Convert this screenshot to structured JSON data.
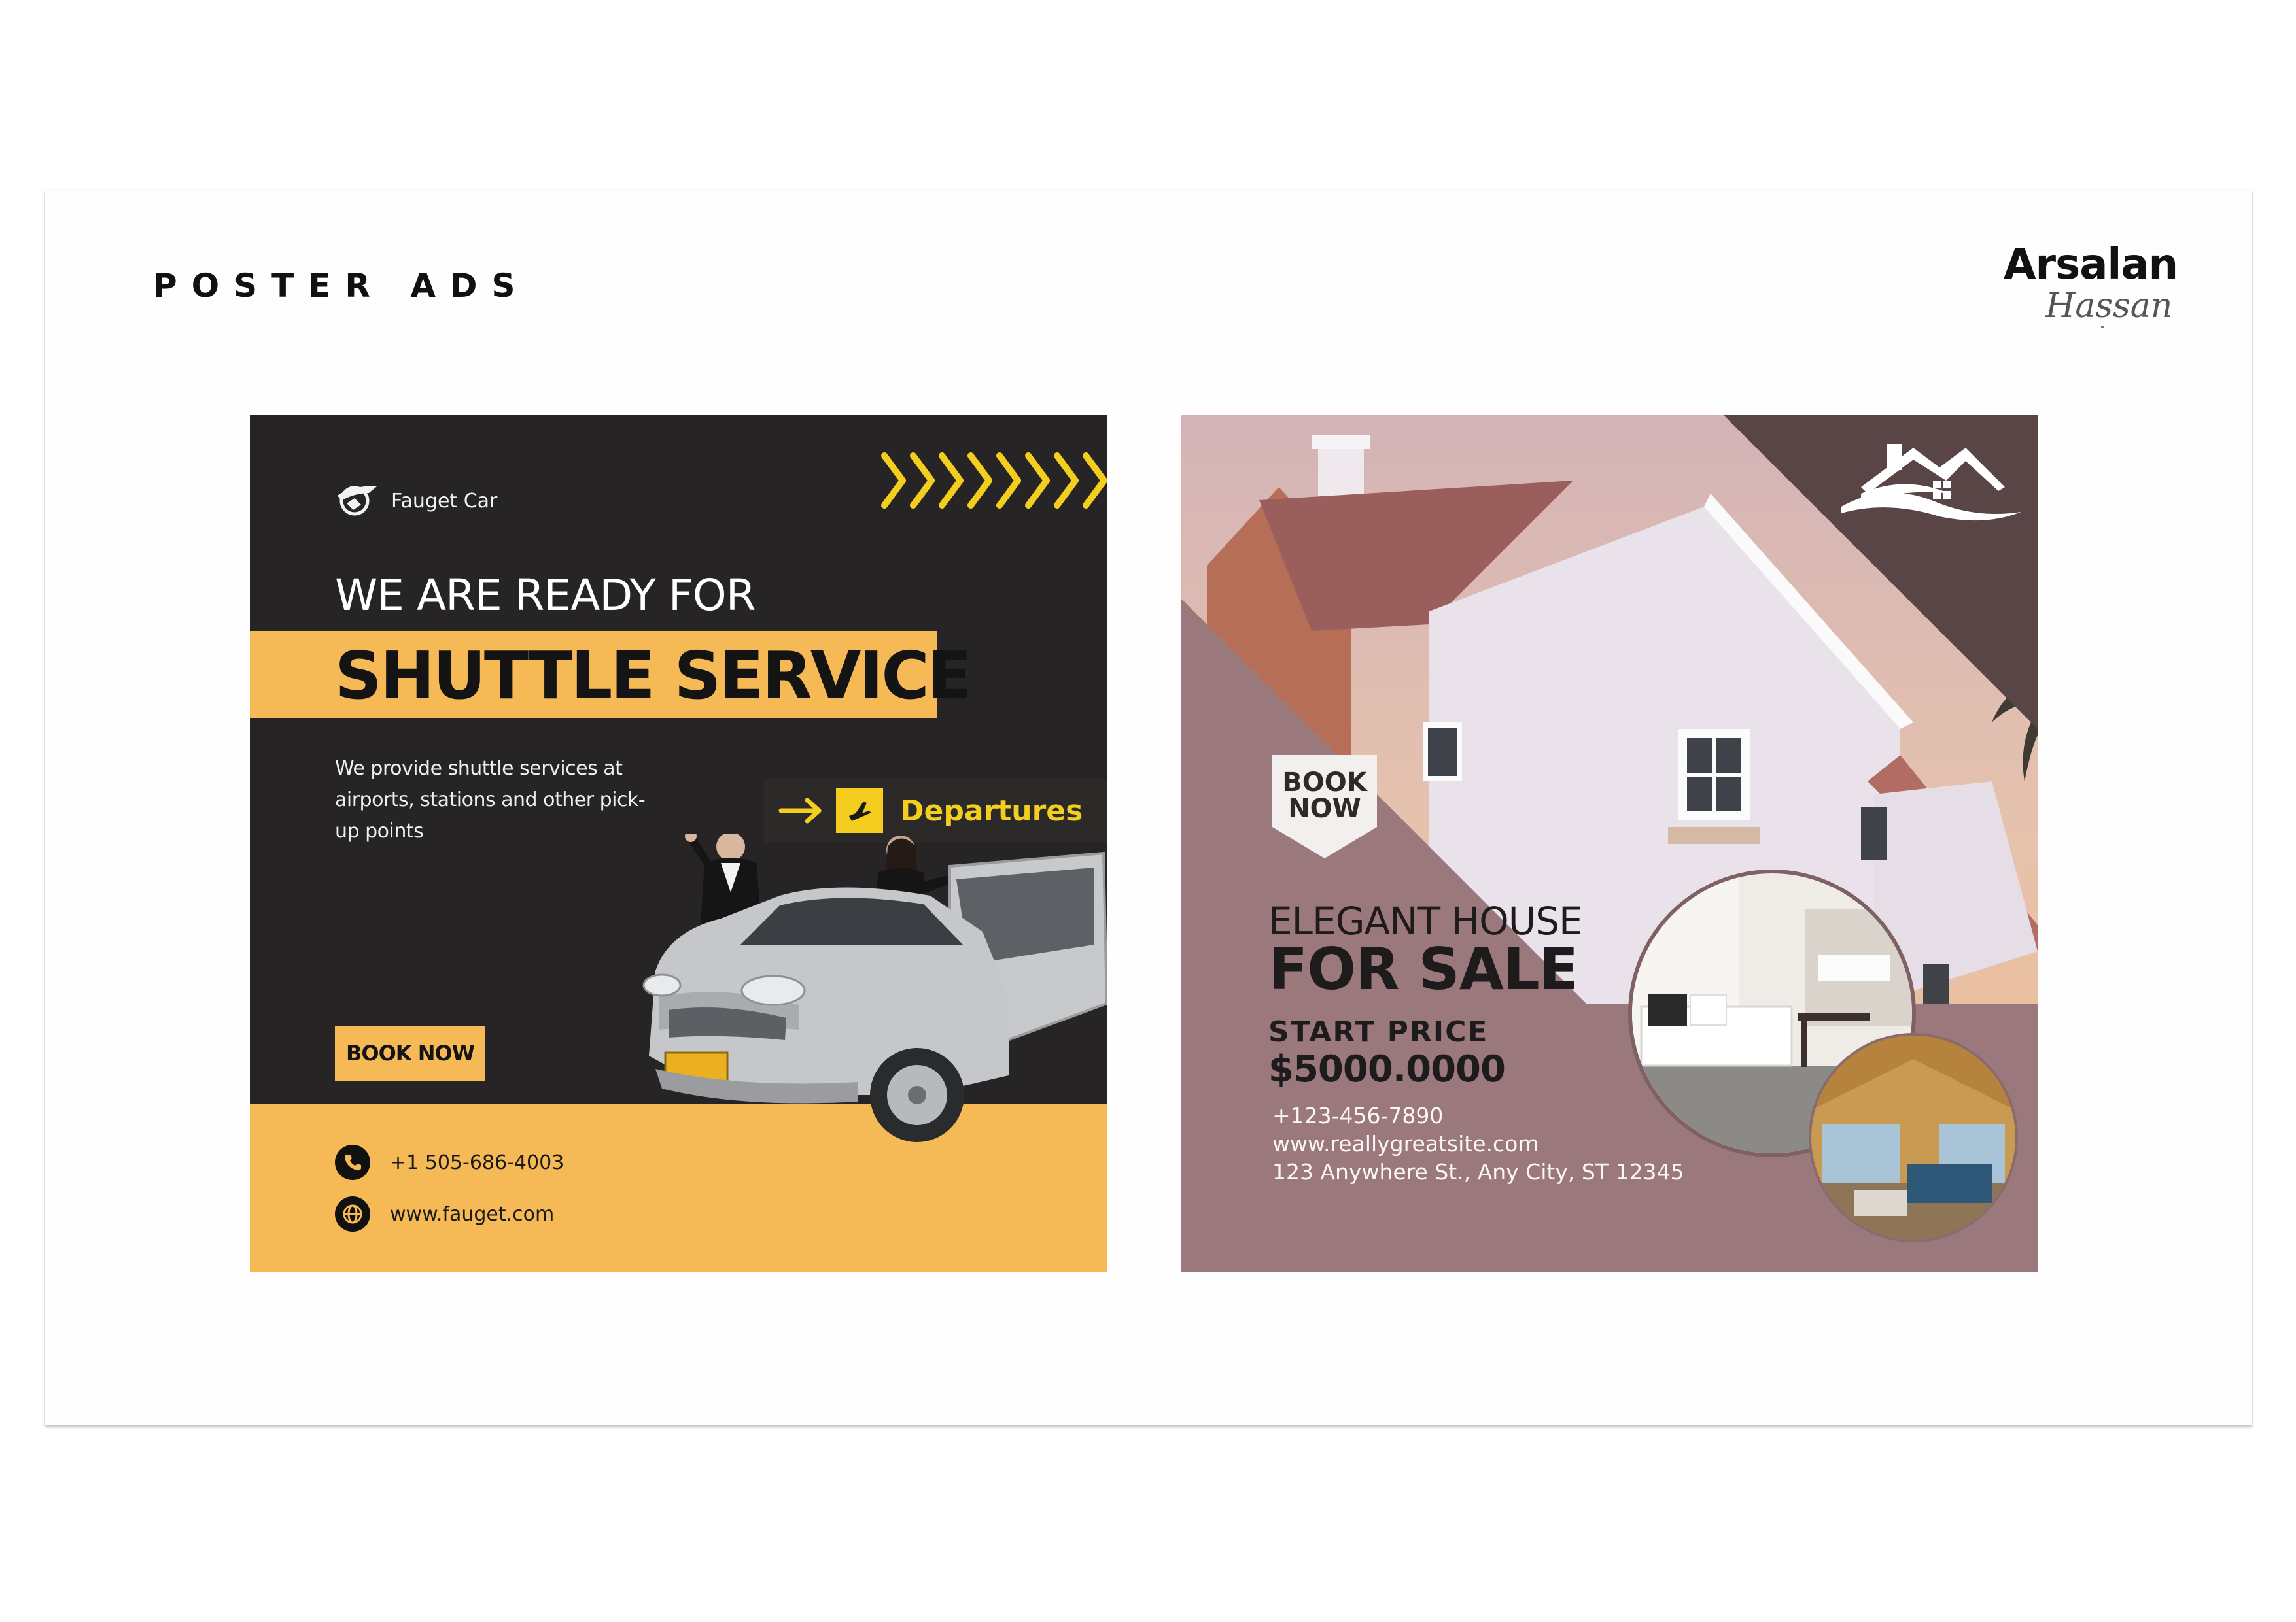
{
  "page": {
    "title": "POSTER ADS"
  },
  "brand": {
    "first_name": "Arsalan",
    "last_name": "Hassan"
  },
  "shuttle_poster": {
    "logo_text": "Fauget Car",
    "headline_line1": "WE ARE READY FOR",
    "headline_line2": "SHUTTLE SERVICE",
    "description": "We provide shuttle services at airports, stations and other pick-up points",
    "sign_label": "Departures",
    "cta": "BOOK NOW",
    "phone": "+1 505-686-4003",
    "website": "www.fauget.com",
    "colors": {
      "dark": "#272425",
      "accent": "#f5b955",
      "sign_yellow": "#f4ce1e"
    }
  },
  "house_poster": {
    "badge": "BOOK NOW",
    "title_line1": "ELEGANT HOUSE",
    "title_line2": "FOR SALE",
    "price_label": "START PRICE",
    "price": "$5000.0000",
    "phone": "+123-456-7890",
    "website": "www.reallygreatsite.com",
    "address": "123 Anywhere St., Any City, ST 12345",
    "colors": {
      "mauve": "#9b787b",
      "dark_brown": "#5a4546"
    }
  }
}
